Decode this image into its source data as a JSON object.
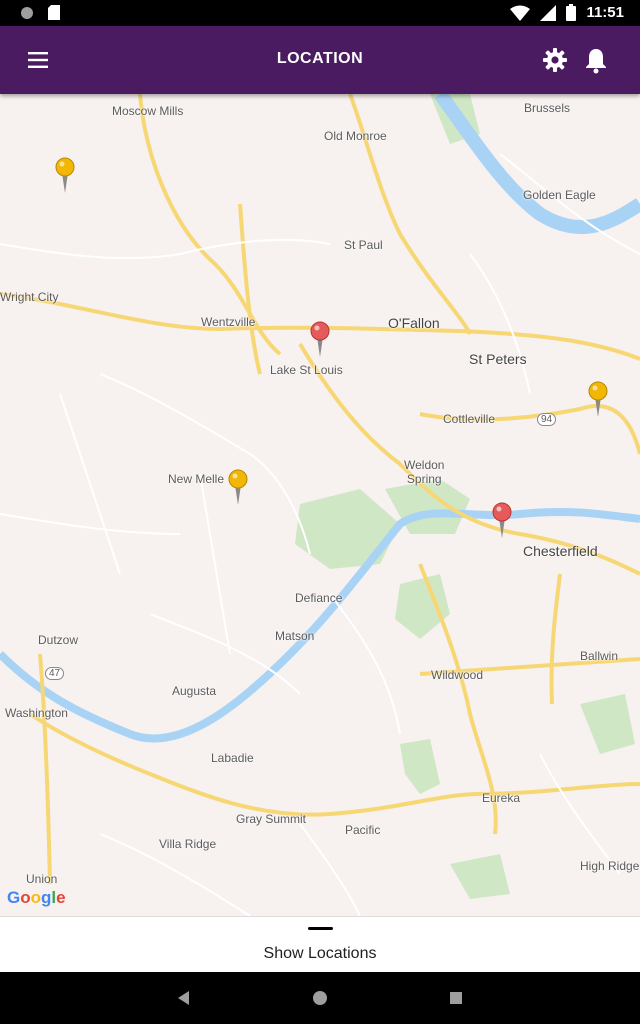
{
  "status_bar": {
    "time": "11:51",
    "icons": [
      "circle-icon",
      "sim-card-icon",
      "wifi-icon",
      "signal-icon",
      "battery-icon"
    ]
  },
  "app_bar": {
    "title": "LOCATION",
    "icons": [
      "menu-icon",
      "gear-icon",
      "bell-icon"
    ],
    "background": "#4b1b61"
  },
  "map": {
    "places": {
      "moscow_mills": "Moscow Mills",
      "old_monroe": "Old Monroe",
      "brussels": "Brussels",
      "golden_eagle": "Golden Eagle",
      "st_paul": "St Paul",
      "wright_city": "Wright City",
      "wentzville": "Wentzville",
      "ofallon": "O'Fallon",
      "st_peters": "St Peters",
      "lake_st_louis": "Lake St Louis",
      "cottleville": "Cottleville",
      "route_94": "94",
      "weldon_spring": "Weldon\nSpring",
      "new_melle": "New Melle",
      "chesterfield": "Chesterfield",
      "defiance": "Defiance",
      "dutzow": "Dutzow",
      "matson": "Matson",
      "ballwin": "Ballwin",
      "route_47": "47",
      "wildwood": "Wildwood",
      "augusta": "Augusta",
      "washington": "Washington",
      "labadie": "Labadie",
      "eureka": "Eureka",
      "gray_summit": "Gray Summit",
      "pacific": "Pacific",
      "villa_ridge": "Villa Ridge",
      "high_ridge": "High Ridge",
      "union": "Union"
    },
    "markers": [
      {
        "color": "#f2b705",
        "name": "yellow"
      },
      {
        "color": "#e55a5a",
        "name": "red"
      },
      {
        "color": "#f2b705",
        "name": "yellow"
      },
      {
        "color": "#f2b705",
        "name": "yellow"
      },
      {
        "color": "#e55a5a",
        "name": "red"
      }
    ],
    "logo": "Google"
  },
  "bottom_sheet": {
    "label": "Show Locations"
  },
  "nav_bar": {
    "icons": [
      "back-icon",
      "home-icon",
      "recents-icon"
    ]
  }
}
